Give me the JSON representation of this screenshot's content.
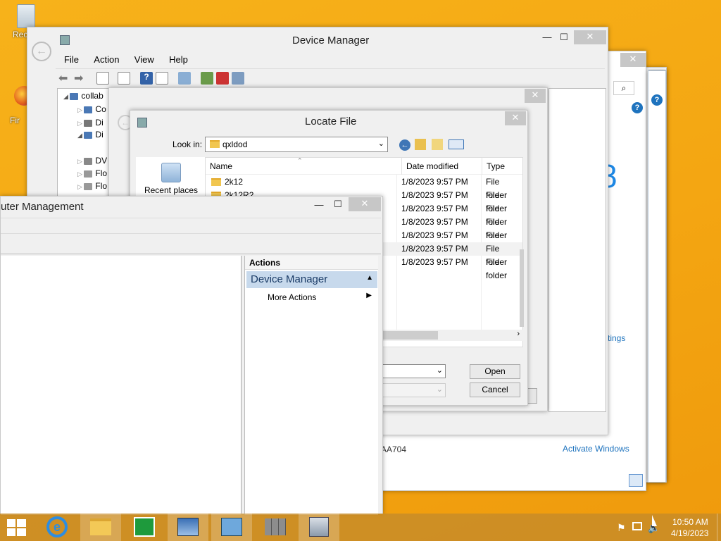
{
  "desktop": {
    "recycle_label": "Recyc",
    "firefox_label": "Fir"
  },
  "device_manager": {
    "title": "Device Manager",
    "menu": [
      "File",
      "Action",
      "View",
      "Help"
    ],
    "tree": {
      "root": "collab",
      "items": [
        "Co",
        "Di",
        "Di",
        "DV",
        "Flo",
        "Flo"
      ]
    }
  },
  "right_panel": {
    "activate": "Activate Windows",
    "settings_link": "tings",
    "code": "AA704",
    "big_digit": "8"
  },
  "locate_file": {
    "title": "Locate File",
    "look_in_label": "Look in:",
    "look_in_value": "qxldod",
    "recent_places": "Recent places",
    "columns": [
      "Name",
      "Date modified",
      "Type"
    ],
    "files": [
      {
        "name": "2k12",
        "date": "1/8/2023 9:57 PM",
        "type": "File folder"
      },
      {
        "name": "2k12R2",
        "date": "1/8/2023 9:57 PM",
        "type": "File folder"
      },
      {
        "name": "",
        "date": "1/8/2023 9:57 PM",
        "type": "File folder"
      },
      {
        "name": "",
        "date": "1/8/2023 9:57 PM",
        "type": "File folder"
      },
      {
        "name": "",
        "date": "1/8/2023 9:57 PM",
        "type": "File folder"
      },
      {
        "name": "",
        "date": "1/8/2023 9:57 PM",
        "type": "File folder"
      },
      {
        "name": "",
        "date": "1/8/2023 9:57 PM",
        "type": "File folder"
      }
    ],
    "open_label": "Open",
    "cancel_label": "Cancel"
  },
  "computer_management": {
    "title": "uter Management",
    "actions_header": "Actions",
    "device_manager_action": "Device Manager",
    "more_actions": "More Actions"
  },
  "taskbar": {
    "time": "10:50 AM",
    "date": "4/19/2023"
  }
}
